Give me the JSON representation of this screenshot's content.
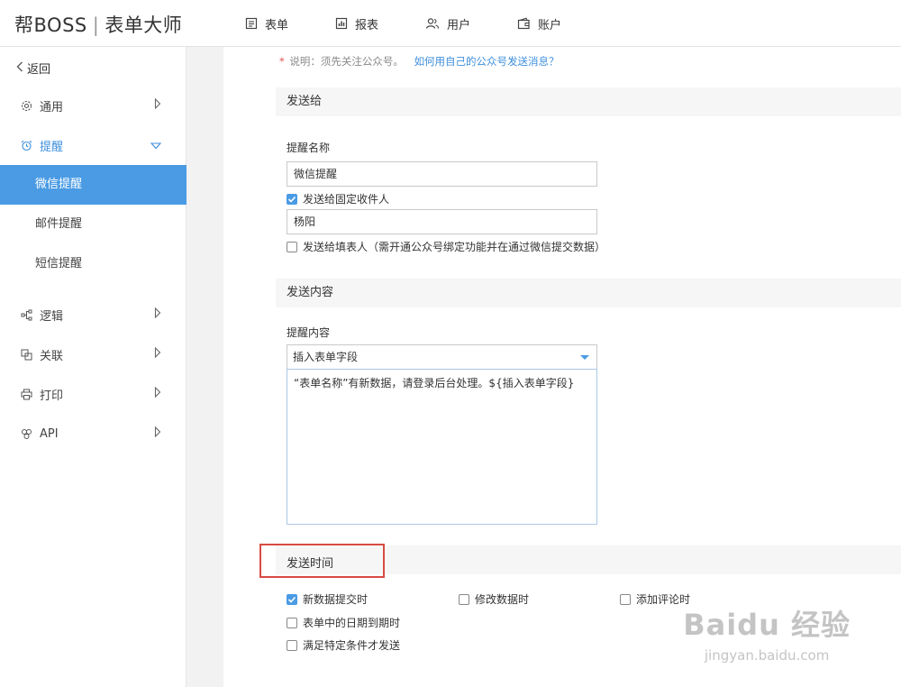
{
  "header": {
    "brand": "帮BOSS",
    "separator": "|",
    "product": "表单大师",
    "nav": [
      {
        "label": "表单",
        "icon": "form-icon"
      },
      {
        "label": "报表",
        "icon": "report-icon"
      },
      {
        "label": "用户",
        "icon": "users-icon"
      },
      {
        "label": "账户",
        "icon": "wallet-icon"
      }
    ]
  },
  "sidebar": {
    "back_label": "返回",
    "items": [
      {
        "label": "通用",
        "icon": "gear-icon"
      },
      {
        "label": "提醒",
        "icon": "alarm-clock-icon",
        "expanded": true
      },
      {
        "label": "逻辑",
        "icon": "logic-flow-icon"
      },
      {
        "label": "关联",
        "icon": "link-icon"
      },
      {
        "label": "打印",
        "icon": "printer-icon"
      },
      {
        "label": "API",
        "icon": "api-icon"
      }
    ],
    "sub_items": [
      {
        "label": "微信提醒",
        "active": true
      },
      {
        "label": "邮件提醒"
      },
      {
        "label": "短信提醒"
      }
    ]
  },
  "main": {
    "note": {
      "star": "*",
      "text": "说明：须先关注公众号。",
      "link": "如何用自己的公众号发送消息？"
    },
    "send_to": {
      "section_title": "发送给",
      "name_label": "提醒名称",
      "name_value": "微信提醒",
      "fixed_recipient_label": "发送给固定收件人",
      "fixed_recipient_checked": true,
      "recipient_value": "杨阳",
      "filler_label": "发送给填表人（需开通公众号绑定功能并在通过微信提交数据）",
      "filler_checked": false
    },
    "content": {
      "section_title": "发送内容",
      "content_label": "提醒内容",
      "insert_field_selected": "插入表单字段",
      "message_text": "“表单名称”有新数据，请登录后台处理。${插入表单字段}"
    },
    "send_time": {
      "section_title": "发送时间",
      "options": [
        {
          "label": "新数据提交时",
          "checked": true
        },
        {
          "label": "修改数据时",
          "checked": false
        },
        {
          "label": "添加评论时",
          "checked": false
        },
        {
          "label": "表单中的日期到期时",
          "checked": false
        },
        {
          "label": "满足特定条件才发送",
          "checked": false
        }
      ]
    }
  },
  "watermark": {
    "main": "Baidu 经验",
    "sub": "jingyan.baidu.com"
  },
  "colors": {
    "accent": "#4a9be4",
    "highlight_border": "#d94a43",
    "required_star": "#e2504c"
  }
}
